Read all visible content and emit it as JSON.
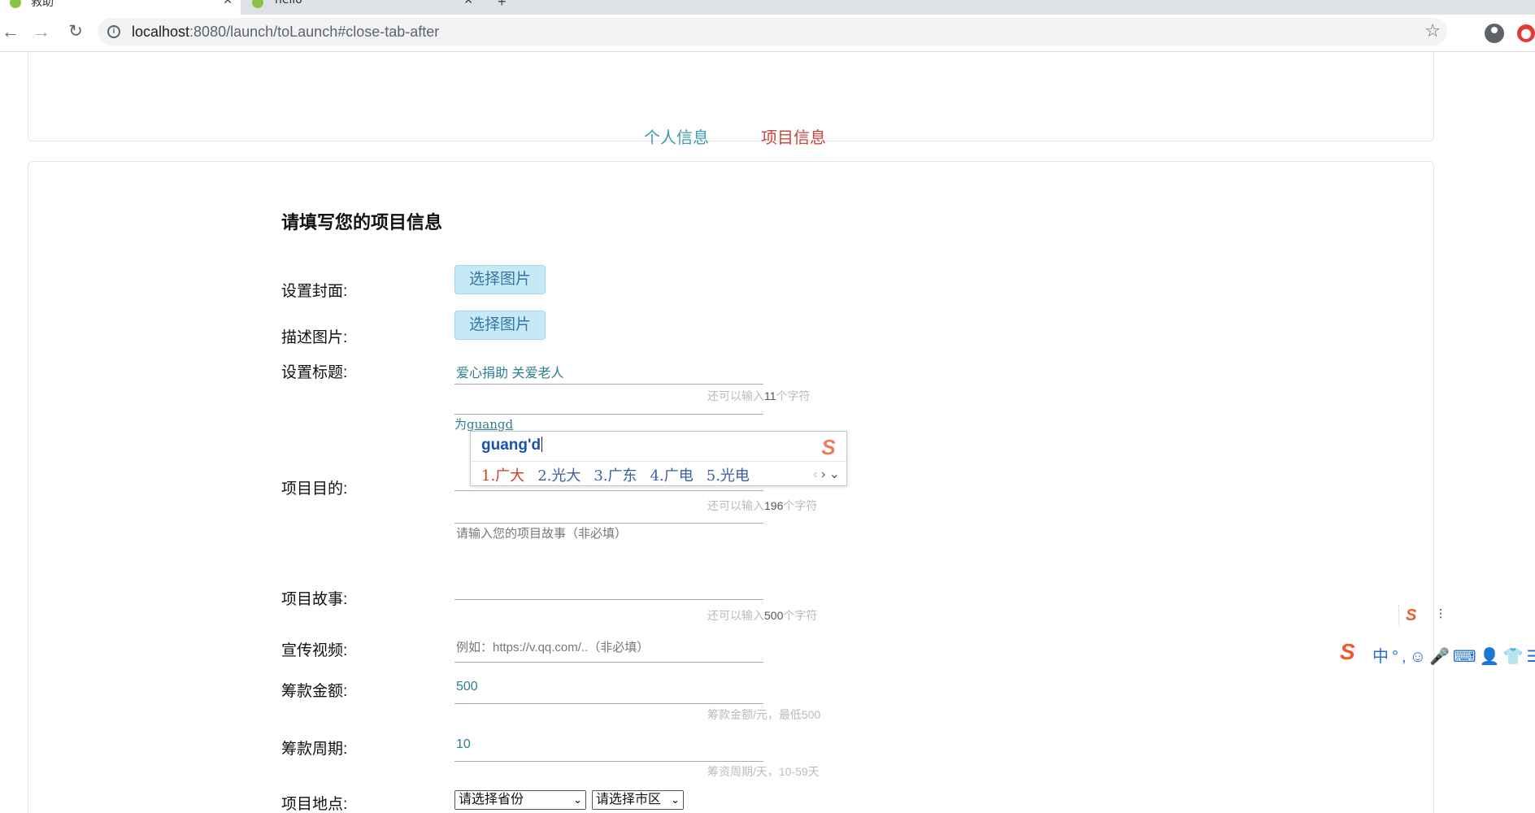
{
  "browser": {
    "tabs": [
      {
        "title": "救助",
        "close": "✕"
      },
      {
        "title": "hello",
        "close": "✕"
      }
    ],
    "new_tab": "+",
    "url_host": "localhost",
    "url_path": ":8080/launch/toLaunch#close-tab-after",
    "info": "i",
    "star": "☆"
  },
  "steps": {
    "personal": "个人信息",
    "project": "项目信息"
  },
  "form": {
    "title": "请填写您的项目信息",
    "cover_label": "设置封面:",
    "cover_button": "选择图片",
    "desc_img_label": "描述图片:",
    "desc_img_button": "选择图片",
    "title_label": "设置标题:",
    "title_value": "爱心捐助 关爱老人",
    "title_hint_pre": "还可以输入",
    "title_hint_num": "11",
    "title_hint_post": "个字符",
    "purpose_label": "项目目的:",
    "purpose_typed_prefix": "为",
    "purpose_typed_pinyin": "guangd",
    "purpose_hint_pre": "还可以输入",
    "purpose_hint_num": "196",
    "purpose_hint_post": "个字符",
    "story_label": "项目故事:",
    "story_placeholder": "请输入您的项目故事（非必填）",
    "story_hint_pre": "还可以输入",
    "story_hint_num": "500",
    "story_hint_post": "个字符",
    "video_label": "宣传视频:",
    "video_placeholder": "例如：https://v.qq.com/..（非必填）",
    "amount_label": "筹款金额:",
    "amount_value": "500",
    "amount_hint": "筹款金额/元，最低500",
    "period_label": "筹款周期:",
    "period_value": "10",
    "period_hint": "筹资周期/天，10-59天",
    "location_label": "项目地点:",
    "province_select": "请选择省份",
    "city_select": "请选择市区"
  },
  "ime": {
    "composition": "guang'd",
    "candidates": [
      "1.广大",
      "2.光大",
      "3.广东",
      "4.广电",
      "5.光电"
    ],
    "prev": "‹",
    "next": "›",
    "expand": "⌄",
    "logo": "S"
  },
  "ime_toolbar": {
    "logo": "S",
    "mode": "中",
    "punct": "°,",
    "emoji": "☺",
    "mic": "🎤",
    "keyboard": "⌨",
    "user": "👤",
    "skin": "👕",
    "menu": "☰",
    "mini_logo": "S",
    "mini_more": "⋮"
  }
}
